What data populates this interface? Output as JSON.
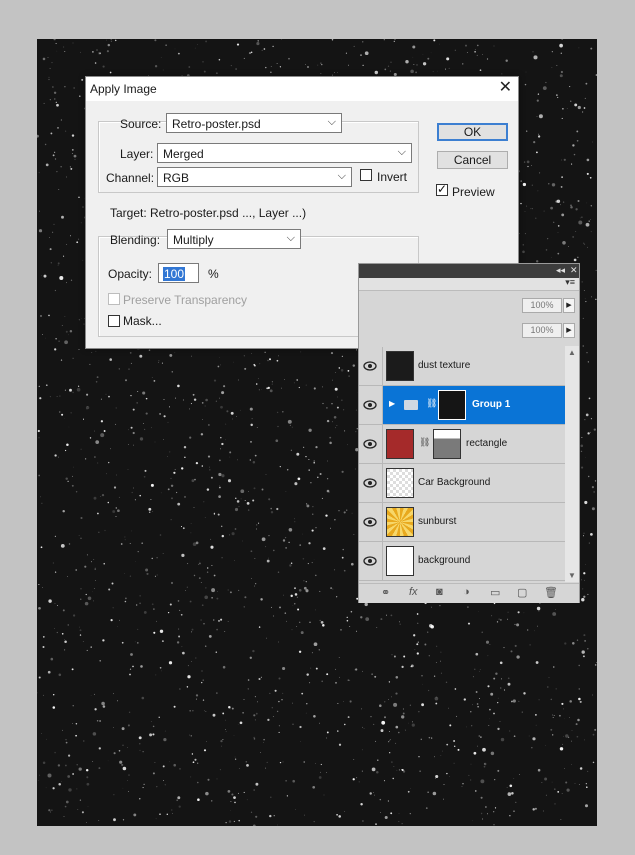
{
  "dialog": {
    "title": "Apply Image",
    "source_label": "Source:",
    "source_value": "Retro-poster.psd",
    "layer_label": "Layer:",
    "layer_value": "Merged",
    "channel_label": "Channel:",
    "channel_value": "RGB",
    "invert_label": "Invert",
    "invert_checked": false,
    "target_text": "Target:   Retro-poster.psd ..., Layer ...)",
    "blending_label": "Blending:",
    "blending_value": "Multiply",
    "opacity_label": "Opacity:",
    "opacity_value": "100",
    "opacity_unit": "%",
    "preserve_label": "Preserve Transparency",
    "mask_label": "Mask...",
    "ok_label": "OK",
    "cancel_label": "Cancel",
    "preview_label": "Preview",
    "preview_checked": true
  },
  "layers_panel": {
    "opacity_display": "100%",
    "fill_display": "100%",
    "layers": [
      {
        "name": "dust texture",
        "selected": false,
        "thumb": "dust"
      },
      {
        "name": "Group 1",
        "selected": true,
        "thumb": "group"
      },
      {
        "name": "rectangle",
        "selected": false,
        "thumb": "red"
      },
      {
        "name": "Car Background",
        "selected": false,
        "thumb": "car"
      },
      {
        "name": "sunburst",
        "selected": false,
        "thumb": "sunburst"
      },
      {
        "name": "background",
        "selected": false,
        "thumb": "white"
      }
    ]
  },
  "colors": {
    "selection_blue": "#0a74d6",
    "rectangle_red": "#a52a2a",
    "sunburst_yellow": "#e8a91e"
  }
}
